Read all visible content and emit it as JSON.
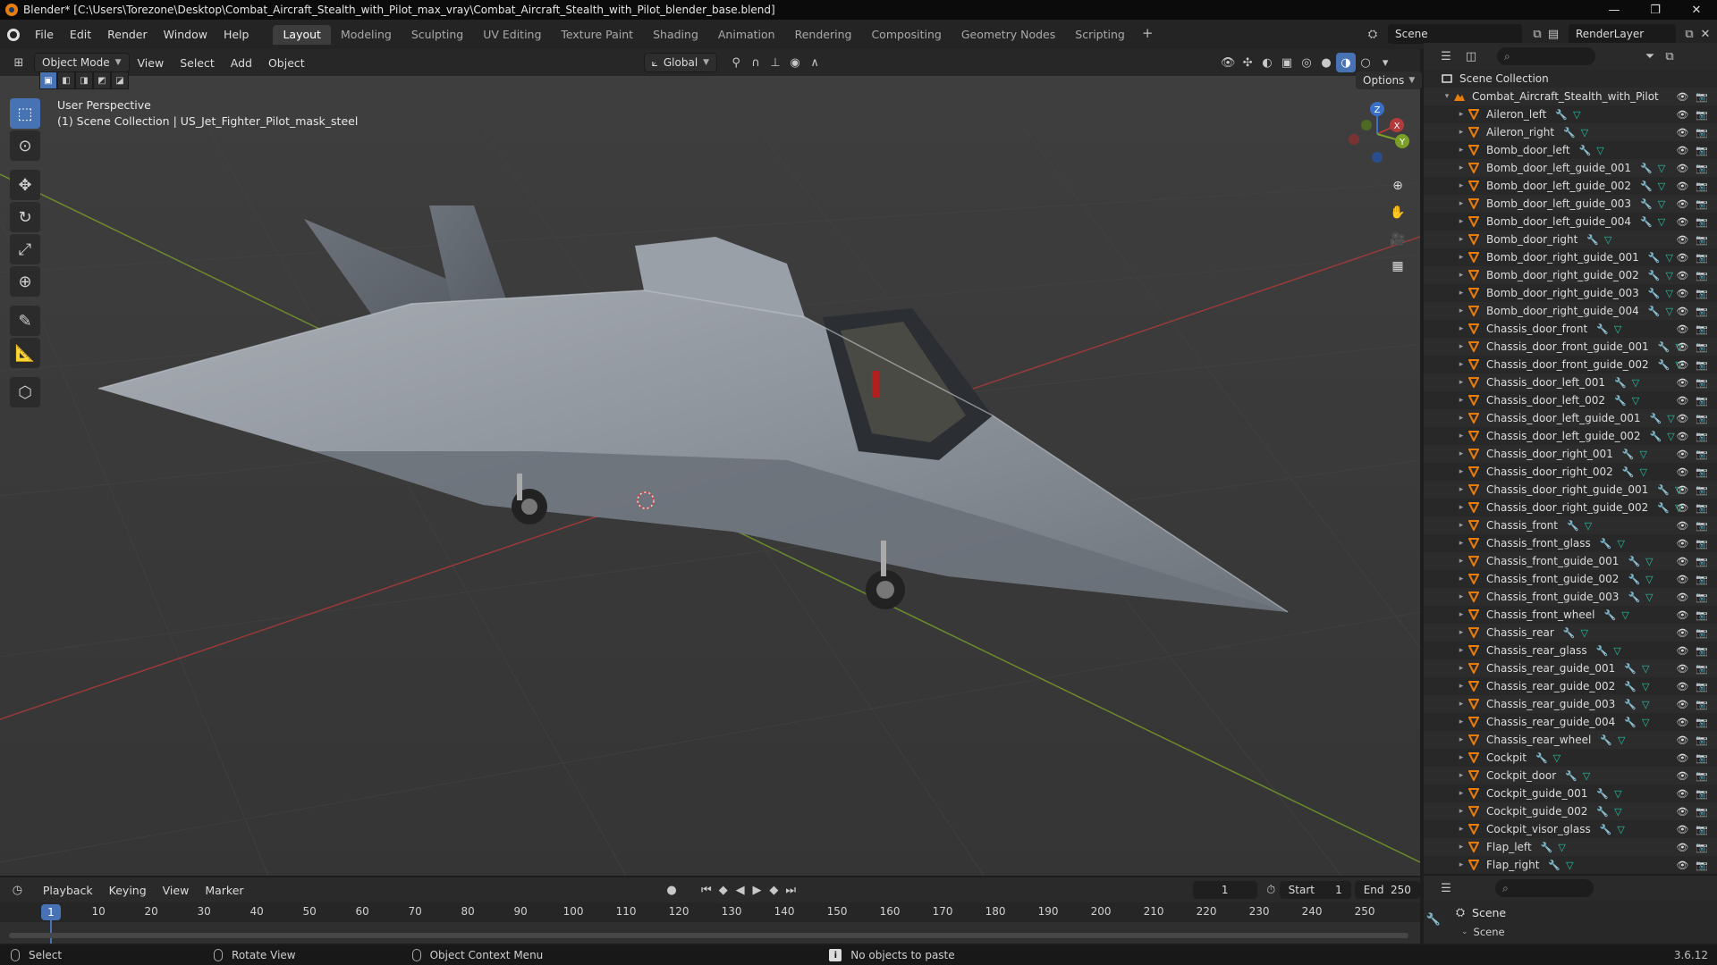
{
  "window": {
    "title": "Blender* [C:\\Users\\Torezone\\Desktop\\Combat_Aircraft_Stealth_with_Pilot_max_vray\\Combat_Aircraft_Stealth_with_Pilot_blender_base.blend]",
    "controls": [
      "—",
      "❐",
      "✕"
    ]
  },
  "menu": [
    "File",
    "Edit",
    "Render",
    "Window",
    "Help"
  ],
  "workspaces": [
    "Layout",
    "Modeling",
    "Sculpting",
    "UV Editing",
    "Texture Paint",
    "Shading",
    "Animation",
    "Rendering",
    "Compositing",
    "Geometry Nodes",
    "Scripting"
  ],
  "active_workspace": "Layout",
  "scene_name": "Scene",
  "render_layer": "RenderLayer",
  "viewport": {
    "mode": "Object Mode",
    "menus": [
      "View",
      "Select",
      "Add",
      "Object"
    ],
    "orientation": "Global",
    "options": "Options",
    "info_line1": "User Perspective",
    "info_line2": "(1) Scene Collection | US_Jet_Fighter_Pilot_mask_steel",
    "gizmo": {
      "x": "X",
      "y": "Y",
      "z": "Z"
    }
  },
  "outliner": {
    "root": "Scene Collection",
    "collection": "Combat_Aircraft_Stealth_with_Pilot",
    "items": [
      "Aileron_left",
      "Aileron_right",
      "Bomb_door_left",
      "Bomb_door_left_guide_001",
      "Bomb_door_left_guide_002",
      "Bomb_door_left_guide_003",
      "Bomb_door_left_guide_004",
      "Bomb_door_right",
      "Bomb_door_right_guide_001",
      "Bomb_door_right_guide_002",
      "Bomb_door_right_guide_003",
      "Bomb_door_right_guide_004",
      "Chassis_door_front",
      "Chassis_door_front_guide_001",
      "Chassis_door_front_guide_002",
      "Chassis_door_left_001",
      "Chassis_door_left_002",
      "Chassis_door_left_guide_001",
      "Chassis_door_left_guide_002",
      "Chassis_door_right_001",
      "Chassis_door_right_002",
      "Chassis_door_right_guide_001",
      "Chassis_door_right_guide_002",
      "Chassis_front",
      "Chassis_front_glass",
      "Chassis_front_guide_001",
      "Chassis_front_guide_002",
      "Chassis_front_guide_003",
      "Chassis_front_wheel",
      "Chassis_rear",
      "Chassis_rear_glass",
      "Chassis_rear_guide_001",
      "Chassis_rear_guide_002",
      "Chassis_rear_guide_003",
      "Chassis_rear_guide_004",
      "Chassis_rear_wheel",
      "Cockpit",
      "Cockpit_door",
      "Cockpit_guide_001",
      "Cockpit_guide_002",
      "Cockpit_visor_glass",
      "Flap_left",
      "Flap_right"
    ]
  },
  "properties": {
    "scene_label": "Scene",
    "sub_label": "Scene"
  },
  "timeline": {
    "menus": [
      "Playback",
      "Keying",
      "View",
      "Marker"
    ],
    "current_frame": "1",
    "start_label": "Start",
    "start": "1",
    "end_label": "End",
    "end": "250",
    "ticks": [
      "10",
      "20",
      "30",
      "40",
      "50",
      "60",
      "70",
      "80",
      "90",
      "100",
      "110",
      "120",
      "130",
      "140",
      "150",
      "160",
      "170",
      "180",
      "190",
      "200",
      "210",
      "220",
      "230",
      "240",
      "250"
    ],
    "playhead_label": "1"
  },
  "status": {
    "select": "Select",
    "rotate": "Rotate View",
    "context": "Object Context Menu",
    "message": "No objects to paste",
    "version": "3.6.12"
  },
  "colors": {
    "accent": "#4772b3",
    "object_icon": "#e87d0d",
    "axis_x": "#b33a3a",
    "axis_y": "#7aa028",
    "modifier": "#6d9ad8",
    "mesh": "#22c3a3"
  }
}
